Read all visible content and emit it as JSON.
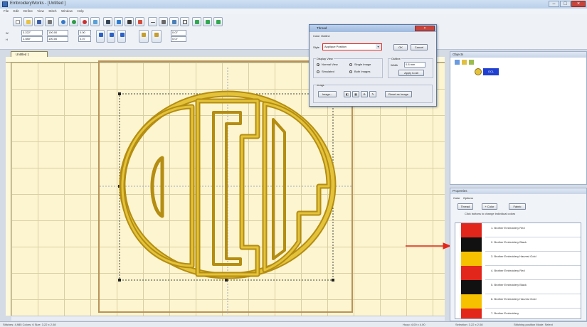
{
  "titlebar": {
    "title": "EmbroideryWorks - [Untitled ]",
    "minimize": "–",
    "maximize": "□",
    "close": "×"
  },
  "menubar": {
    "items": [
      "File",
      "Edit",
      "Define",
      "View",
      "Stitch",
      "Window",
      "Help"
    ]
  },
  "toolbar": {
    "width_label": "W",
    "height_label": "H",
    "x_value": "3.222\"",
    "y_value": "2.080\"",
    "w_value": "100.00",
    "h_value": "100.00",
    "angle_value": "0.00",
    "spacing_value": "0.07",
    "spacing_value2": "0.07",
    "density_value": "0.07"
  },
  "document": {
    "tab": "Untitled 1"
  },
  "panels": {
    "objects": {
      "title": "Objects",
      "item_label": "OCL"
    },
    "properties": {
      "title": "Properties",
      "tabs": [
        "Color",
        "Options"
      ],
      "buttons": [
        "Thread",
        "+ Color",
        "Fabric"
      ],
      "hint": "Click buttons to change individual colors"
    }
  },
  "threads": [
    {
      "name": "1. Brother Embroidery Red",
      "color": "#e3261c"
    },
    {
      "name": "2. Brother Embroidery Black",
      "color": "#111111"
    },
    {
      "name": "3. Brother Embroidery Harvest Gold",
      "color": "#f6c200"
    },
    {
      "name": "4. Brother Embroidery Red",
      "color": "#e3261c"
    },
    {
      "name": "5. Brother Embroidery Black",
      "color": "#111111"
    },
    {
      "name": "6. Brother Embroidery Harvest Gold",
      "color": "#f6c200"
    },
    {
      "name": "7. Brother Embroidery",
      "color": "#e3261c"
    }
  ],
  "dialog": {
    "title": "Thread",
    "tabs": [
      "Color",
      "Outline"
    ],
    "style_label": "Style",
    "style_value": "Applique Position",
    "ok": "OK",
    "cancel": "Cancel",
    "group_view": "Display View",
    "radio_1": "Normal View",
    "radio_2": "Single Image",
    "radio_3": "Simulated",
    "radio_4": "Both Images",
    "group_outline": "Outline",
    "width_label": "Width",
    "width_value": "0.8 mm",
    "apply_label": "Apply to All",
    "group_image": "Image",
    "image_button": "Image...",
    "reset_image": "Reset as Image"
  },
  "colors": {
    "gold": "#c9a11a",
    "gold_dark": "#8a6d0d",
    "canvas": "#fdf5cf",
    "accent_red": "#e3261c"
  },
  "status": {
    "left": "Stitches: 4,985  Colors: 6  Size: 3.22 x 2.08",
    "middle": "Hoop: 4.00 x 4.00",
    "right": "Selection: 3.22 x 2.08",
    "far_right": "Stitching position   Mode: Select"
  },
  "annotations": {
    "arrow_color": "#e3261c"
  }
}
